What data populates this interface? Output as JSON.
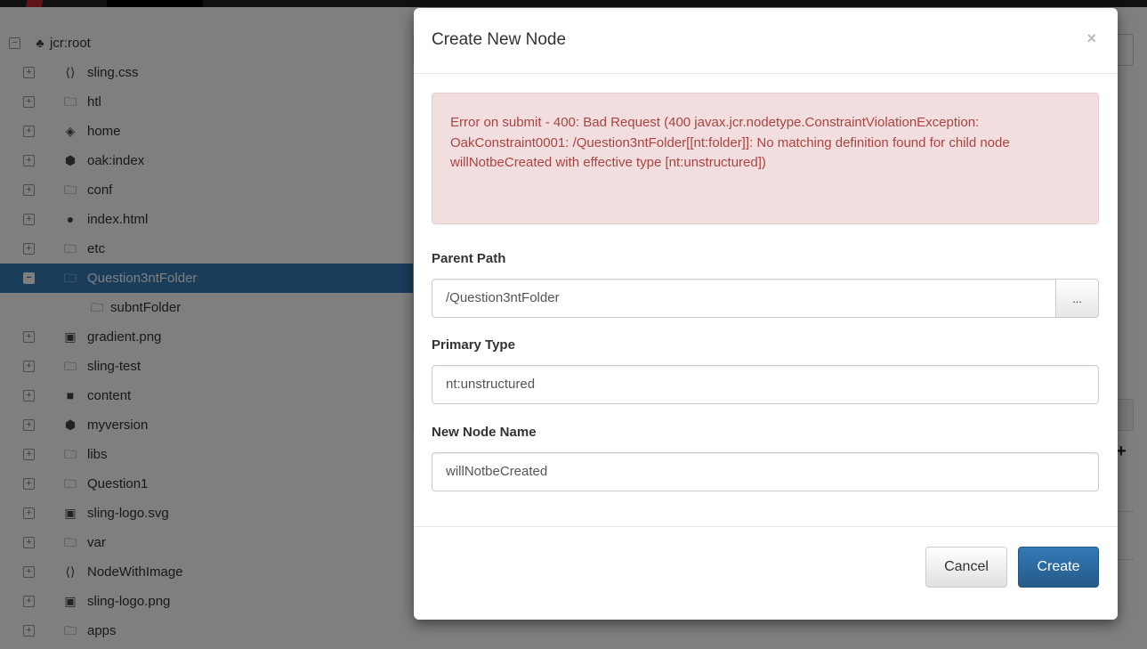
{
  "tree": {
    "root_label": "jcr:root",
    "items": [
      {
        "label": "sling.css",
        "icon": "code-file-icon",
        "glyph": "⟨⟩",
        "toggle": "+"
      },
      {
        "label": "htl",
        "icon": "folder-icon",
        "glyph": "🗀",
        "toggle": "+"
      },
      {
        "label": "home",
        "icon": "gem-icon",
        "glyph": "◈",
        "toggle": "+"
      },
      {
        "label": "oak:index",
        "icon": "cube-icon",
        "glyph": "⬢",
        "toggle": "+"
      },
      {
        "label": "conf",
        "icon": "folder-icon",
        "glyph": "🗀",
        "toggle": "+"
      },
      {
        "label": "index.html",
        "icon": "globe-icon",
        "glyph": "●",
        "toggle": "+"
      },
      {
        "label": "etc",
        "icon": "folder-icon",
        "glyph": "🗀",
        "toggle": "+"
      },
      {
        "label": "Question3ntFolder",
        "icon": "folder-icon",
        "glyph": "🗀",
        "toggle": "−",
        "selected": true
      },
      {
        "label": "subntFolder",
        "icon": "folder-icon",
        "glyph": "🗀",
        "toggle": "",
        "child": true
      },
      {
        "label": "gradient.png",
        "icon": "image-file-icon",
        "glyph": "▣",
        "toggle": "+"
      },
      {
        "label": "sling-test",
        "icon": "folder-icon",
        "glyph": "🗀",
        "toggle": "+"
      },
      {
        "label": "content",
        "icon": "folder-filled-icon",
        "glyph": "■",
        "toggle": "+"
      },
      {
        "label": "myversion",
        "icon": "cube-icon",
        "glyph": "⬢",
        "toggle": "+"
      },
      {
        "label": "libs",
        "icon": "folder-icon",
        "glyph": "🗀",
        "toggle": "+"
      },
      {
        "label": "Question1",
        "icon": "folder-icon",
        "glyph": "🗀",
        "toggle": "+"
      },
      {
        "label": "sling-logo.svg",
        "icon": "image-file-icon",
        "glyph": "▣",
        "toggle": "+"
      },
      {
        "label": "var",
        "icon": "folder-icon",
        "glyph": "🗀",
        "toggle": "+"
      },
      {
        "label": "NodeWithImage",
        "icon": "code-file-icon",
        "glyph": "⟨⟩",
        "toggle": "+"
      },
      {
        "label": "sling-logo.png",
        "icon": "image-file-icon",
        "glyph": "▣",
        "toggle": "+"
      },
      {
        "label": "apps",
        "icon": "folder-icon",
        "glyph": "🗀",
        "toggle": "+"
      }
    ]
  },
  "modal": {
    "title": "Create New Node",
    "close": "×",
    "error": "Error on submit - 400: Bad Request (400 javax.jcr.nodetype.ConstraintViolationException: OakConstraint0001: /Question3ntFolder[[nt:folder]]: No matching definition found for child node willNotbeCreated with effective type [nt:unstructured])",
    "parent_path": {
      "label": "Parent Path",
      "value": "/Question3ntFolder",
      "browse": "..."
    },
    "primary_type": {
      "label": "Primary Type",
      "value": "nt:unstructured"
    },
    "node_name": {
      "label": "New Node Name",
      "value": "willNotbeCreated"
    },
    "cancel_label": "Cancel",
    "create_label": "Create"
  },
  "background": {
    "plus": "+"
  },
  "colors": {
    "selected": "#337ab7",
    "error_bg": "#f2dede",
    "error_text": "#a94442",
    "primary_btn": "#337ab7"
  }
}
